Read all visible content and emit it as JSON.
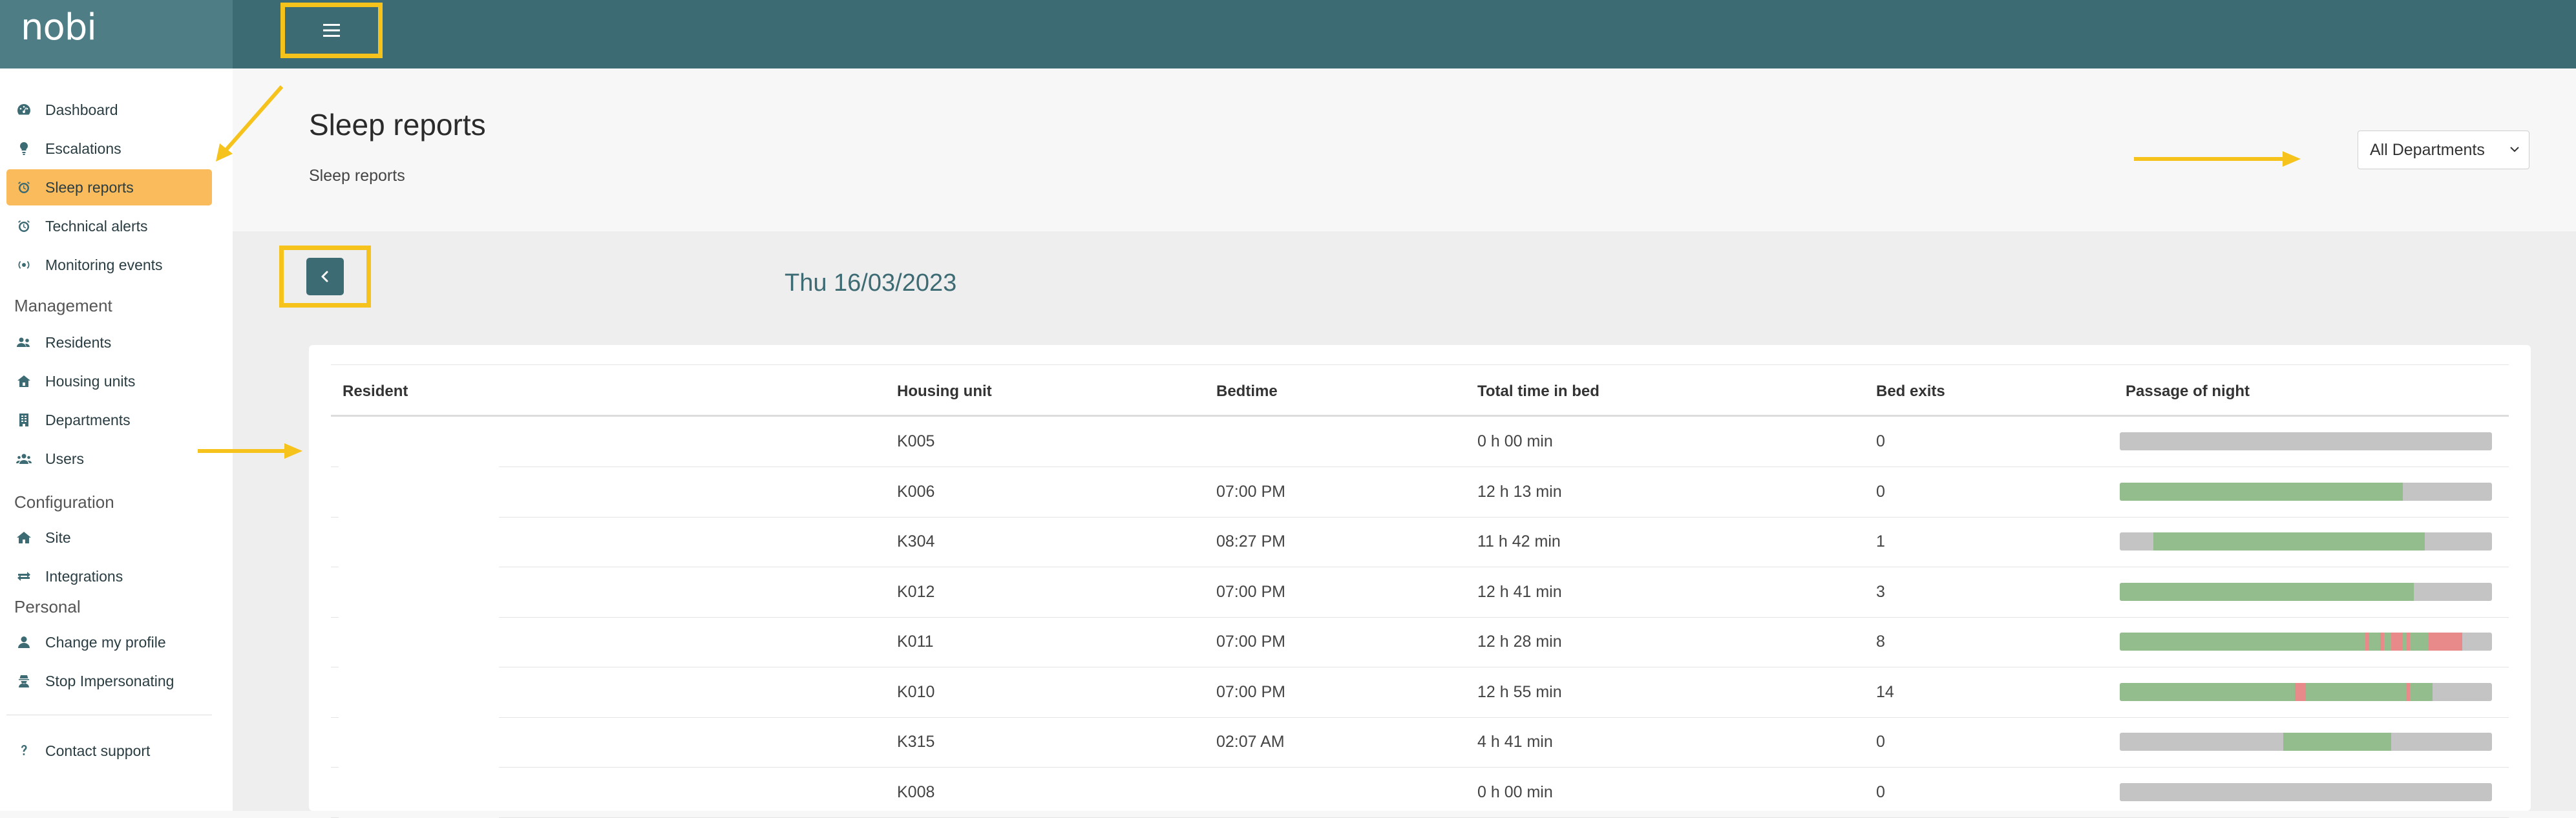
{
  "app": {
    "logo": "nobi"
  },
  "topbar": {
    "menu_icon": "hamburger-icon"
  },
  "sidebar": {
    "main": [
      {
        "label": "Dashboard",
        "icon": "gauge-icon"
      },
      {
        "label": "Escalations",
        "icon": "lightbulb-icon"
      },
      {
        "label": "Sleep reports",
        "icon": "alarm-clock-icon",
        "active": true
      },
      {
        "label": "Technical alerts",
        "icon": "alarm-clock-icon"
      },
      {
        "label": "Monitoring events",
        "icon": "signal-icon"
      }
    ],
    "management": {
      "title": "Management",
      "items": [
        {
          "label": "Residents",
          "icon": "users-icon"
        },
        {
          "label": "Housing units",
          "icon": "house-icon"
        },
        {
          "label": "Departments",
          "icon": "building-icon"
        },
        {
          "label": "Users",
          "icon": "user-group-icon"
        }
      ]
    },
    "configuration": {
      "title": "Configuration",
      "items": [
        {
          "label": "Site",
          "icon": "home-icon"
        },
        {
          "label": "Integrations",
          "icon": "exchange-icon"
        }
      ]
    },
    "personal": {
      "title": "Personal",
      "items": [
        {
          "label": "Change my profile",
          "icon": "user-icon"
        },
        {
          "label": "Stop Impersonating",
          "icon": "user-secret-icon"
        }
      ]
    },
    "support": {
      "label": "Contact support",
      "icon": "question-icon"
    }
  },
  "page": {
    "title": "Sleep reports",
    "subtitle": "Sleep reports",
    "department_select": "All Departments",
    "date": "Thu 16/03/2023"
  },
  "table": {
    "headers": [
      "Resident",
      "Housing unit",
      "Bedtime",
      "Total time in bed",
      "Bed exits",
      "Passage of night"
    ],
    "rows": [
      {
        "resident": "",
        "unit": "K005",
        "bedtime": "",
        "total": "0 h 00 min",
        "exits": "0",
        "night": []
      },
      {
        "resident": "",
        "unit": "K006",
        "bedtime": "07:00 PM",
        "total": "12 h 13 min",
        "exits": "0",
        "night": [
          [
            0.0,
            0.76,
            "sleep"
          ]
        ]
      },
      {
        "resident": "",
        "unit": "K304",
        "bedtime": "08:27 PM",
        "total": "11 h 42 min",
        "exits": "1",
        "night": [
          [
            0.09,
            0.82,
            "sleep"
          ]
        ]
      },
      {
        "resident": "",
        "unit": "K012",
        "bedtime": "07:00 PM",
        "total": "12 h 41 min",
        "exits": "3",
        "night": [
          [
            0.0,
            0.79,
            "sleep"
          ]
        ]
      },
      {
        "resident": "",
        "unit": "K011",
        "bedtime": "07:00 PM",
        "total": "12 h 28 min",
        "exits": "8",
        "night": [
          [
            0.0,
            0.66,
            "sleep"
          ],
          [
            0.66,
            0.67,
            "exit"
          ],
          [
            0.67,
            0.7,
            "sleep"
          ],
          [
            0.7,
            0.71,
            "exit"
          ],
          [
            0.71,
            0.73,
            "sleep"
          ],
          [
            0.73,
            0.76,
            "exit"
          ],
          [
            0.76,
            0.77,
            "sleep"
          ],
          [
            0.77,
            0.78,
            "exit"
          ],
          [
            0.78,
            0.83,
            "sleep"
          ],
          [
            0.83,
            0.92,
            "exit"
          ]
        ]
      },
      {
        "resident": "",
        "unit": "K010",
        "bedtime": "07:00 PM",
        "total": "12 h 55 min",
        "exits": "14",
        "night": [
          [
            0.0,
            0.47,
            "sleep"
          ],
          [
            0.47,
            0.5,
            "exit"
          ],
          [
            0.5,
            0.77,
            "sleep"
          ],
          [
            0.77,
            0.78,
            "exit"
          ],
          [
            0.78,
            0.84,
            "sleep"
          ]
        ]
      },
      {
        "resident": "",
        "unit": "K315",
        "bedtime": "02:07 AM",
        "total": "4 h 41 min",
        "exits": "0",
        "night": [
          [
            0.44,
            0.73,
            "sleep"
          ]
        ]
      },
      {
        "resident": "",
        "unit": "K008",
        "bedtime": "",
        "total": "0 h 00 min",
        "exits": "0",
        "night": []
      }
    ]
  },
  "colors": {
    "brand": "#3d6b74",
    "active_nav": "#f9bb5c",
    "sleep": "#93bd8d",
    "exit": "#e88a8a",
    "empty": "#c4c4c4",
    "annotation": "#f6c21c"
  }
}
